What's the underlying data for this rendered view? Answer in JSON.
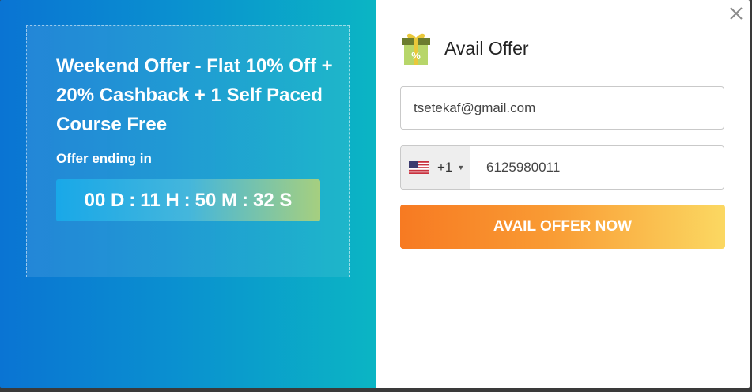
{
  "promo": {
    "title": "Weekend Offer - Flat 10% Off + 20% Cashback + 1 Self Paced Course Free",
    "ending_label": "Offer ending in",
    "countdown": {
      "days": "00 D",
      "hours": "11 H",
      "minutes": "50 M",
      "seconds": "32 S",
      "separator": ":"
    }
  },
  "form": {
    "title": "Avail Offer",
    "email_value": "tsetekaf@gmail.com",
    "country_code": "+1",
    "phone_value": "6125980011",
    "cta_label": "AVAIL OFFER NOW"
  },
  "icons": {
    "close": "close-icon",
    "gift": "gift-percent-icon",
    "flag": "us-flag-icon",
    "caret": "caret-down-icon"
  },
  "colors": {
    "left_gradient_start": "#0a74d3",
    "left_gradient_end": "#0bb5c4",
    "cta_start": "#f77a22",
    "cta_end": "#fbd862"
  }
}
